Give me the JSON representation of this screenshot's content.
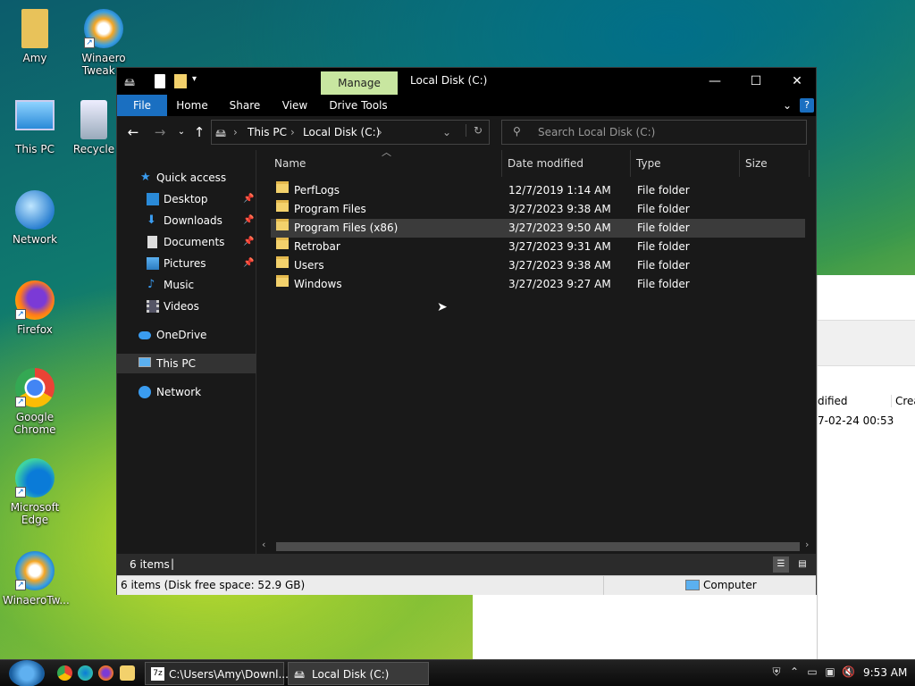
{
  "desktop": {
    "icons": [
      {
        "label": "Amy"
      },
      {
        "label": "Winaero Tweak..."
      },
      {
        "label": "This PC"
      },
      {
        "label": "Recycle"
      },
      {
        "label": "Network"
      },
      {
        "label": "Firefox"
      },
      {
        "label": "Google Chrome"
      },
      {
        "label": "Microsoft Edge"
      },
      {
        "label": "WinaeroTw..."
      }
    ]
  },
  "background_window": {
    "header_modified": "dified",
    "header_created": "Creat",
    "date_value": "7-02-24 00:53"
  },
  "explorer": {
    "title": "Local Disk (C:)",
    "manage_tab": "Manage",
    "ribbon_tabs": [
      "File",
      "Home",
      "Share",
      "View",
      "Drive Tools"
    ],
    "breadcrumb": [
      "This PC",
      "Local Disk (C:)"
    ],
    "search_placeholder": "Search Local Disk (C:)",
    "nav": {
      "quick_access": "Quick access",
      "desktop": "Desktop",
      "downloads": "Downloads",
      "documents": "Documents",
      "pictures": "Pictures",
      "music": "Music",
      "videos": "Videos",
      "onedrive": "OneDrive",
      "this_pc": "This PC",
      "network": "Network"
    },
    "columns": [
      "Name",
      "Date modified",
      "Type",
      "Size"
    ],
    "files": [
      {
        "name": "PerfLogs",
        "date": "12/7/2019 1:14 AM",
        "type": "File folder"
      },
      {
        "name": "Program Files",
        "date": "3/27/2023 9:38 AM",
        "type": "File folder"
      },
      {
        "name": "Program Files (x86)",
        "date": "3/27/2023 9:50 AM",
        "type": "File folder"
      },
      {
        "name": "Retrobar",
        "date": "3/27/2023 9:31 AM",
        "type": "File folder"
      },
      {
        "name": "Users",
        "date": "3/27/2023 9:38 AM",
        "type": "File folder"
      },
      {
        "name": "Windows",
        "date": "3/27/2023 9:27 AM",
        "type": "File folder"
      }
    ],
    "status_items": "6 items",
    "status_detail": "6 items (Disk free space: 52.9 GB)",
    "status_zone": "Computer"
  },
  "taskbar": {
    "item1": "C:\\Users\\Amy\\Downl...",
    "item2": "Local Disk (C:)",
    "clock": "9:53 AM"
  },
  "colors": {
    "ribbon_file": "#1a6fc1",
    "manage_tab": "#c8e6a0",
    "folder": "#f3d16c"
  }
}
